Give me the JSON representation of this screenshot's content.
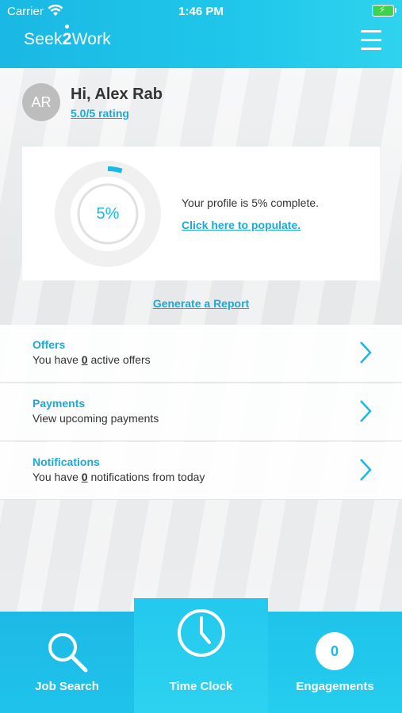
{
  "status_bar": {
    "carrier": "Carrier",
    "time": "1:46 PM"
  },
  "header": {
    "logo_prefix": "Seek",
    "logo_number": "2",
    "logo_suffix": "Work"
  },
  "profile": {
    "initials": "AR",
    "greeting": "Hi, Alex Rab",
    "rating": "5.0/5 rating",
    "completion_percent": 5,
    "completion_label": "5%",
    "complete_text": "Your profile is 5% complete.",
    "populate_link": "Click here to populate."
  },
  "report_link": "Generate a Report",
  "rows": [
    {
      "title": "Offers",
      "sub_pre": "You have ",
      "sub_count": "0",
      "sub_post": " active offers"
    },
    {
      "title": "Payments",
      "sub_pre": "View upcoming payments",
      "sub_count": "",
      "sub_post": ""
    },
    {
      "title": "Notifications",
      "sub_pre": "You have ",
      "sub_count": "0",
      "sub_post": " notifications from today"
    }
  ],
  "tabs": {
    "job_search": "Job Search",
    "time_clock": "Time Clock",
    "engagements": "Engagements",
    "engagements_count": "0"
  },
  "colors": {
    "accent": "#1ab8e4",
    "link": "#1aa9d8",
    "text": "#333333"
  }
}
